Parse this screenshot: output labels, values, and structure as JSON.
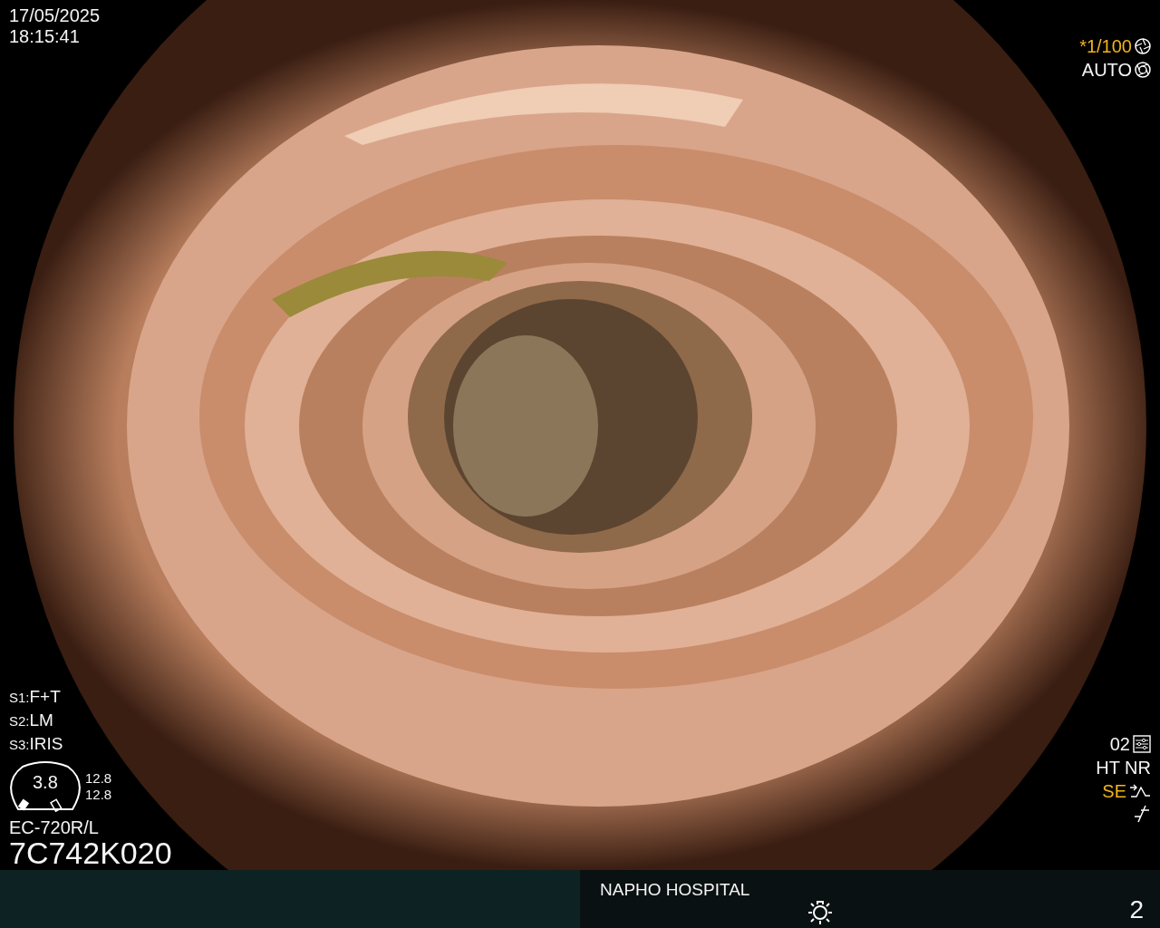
{
  "datetime": {
    "date": "17/05/2025",
    "time": "18:15:41"
  },
  "shutter": {
    "speed": "*1/100",
    "highlighted": true
  },
  "iris": {
    "mode": "AUTO",
    "highlighted": false
  },
  "settings": [
    {
      "label": "S1:",
      "value": "F+T"
    },
    {
      "label": "S2:",
      "value": "LM"
    },
    {
      "label": "S3:",
      "value": "IRIS"
    }
  ],
  "gauge": {
    "value": "3.8",
    "readings": [
      "12.8",
      "12.8"
    ]
  },
  "scope": {
    "model": "EC-720R/L",
    "serial": "7C742K020"
  },
  "right_status": [
    {
      "kind": "preset",
      "text": "02",
      "highlighted": false
    },
    {
      "kind": "plain",
      "text": "HT NR",
      "highlighted": false
    },
    {
      "kind": "enhance",
      "text": "SE",
      "highlighted": true
    },
    {
      "kind": "freeze"
    }
  ],
  "footer": {
    "hospital": "NAPHO HOSPITAL",
    "page": "2"
  }
}
